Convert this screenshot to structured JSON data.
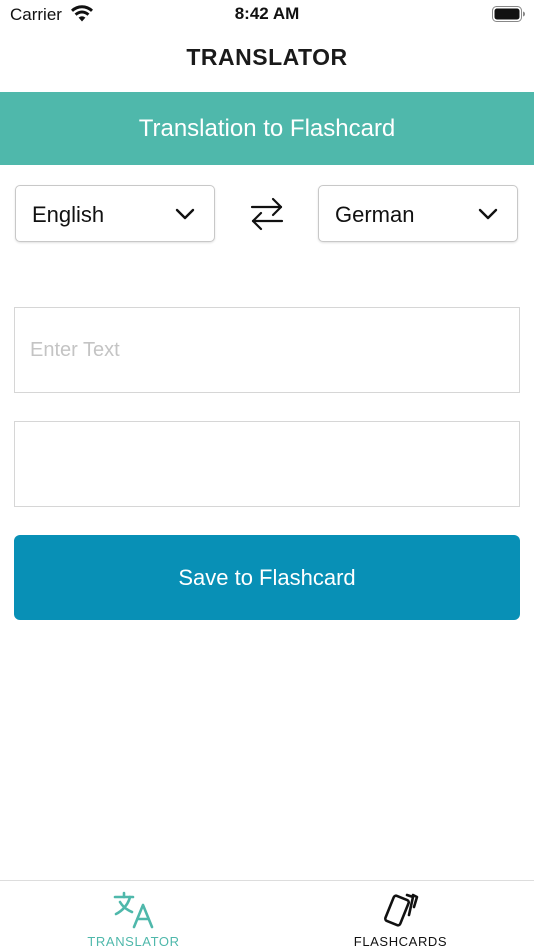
{
  "status_bar": {
    "carrier": "Carrier",
    "time": "8:42 AM"
  },
  "nav": {
    "title": "TRANSLATOR"
  },
  "banner": {
    "text": "Translation to Flashcard"
  },
  "languages": {
    "source": "English",
    "target": "German"
  },
  "input": {
    "placeholder": "Enter Text",
    "value": ""
  },
  "output": {
    "value": ""
  },
  "save_button": {
    "label": "Save to Flashcard"
  },
  "tabs": [
    {
      "label": "TRANSLATOR",
      "icon": "translate-icon",
      "active": true
    },
    {
      "label": "FLASHCARDS",
      "icon": "flashcards-icon",
      "active": false
    }
  ],
  "colors": {
    "banner": "#4fb8ab",
    "button": "#0890b6",
    "active_tab": "#4fb8ab"
  }
}
